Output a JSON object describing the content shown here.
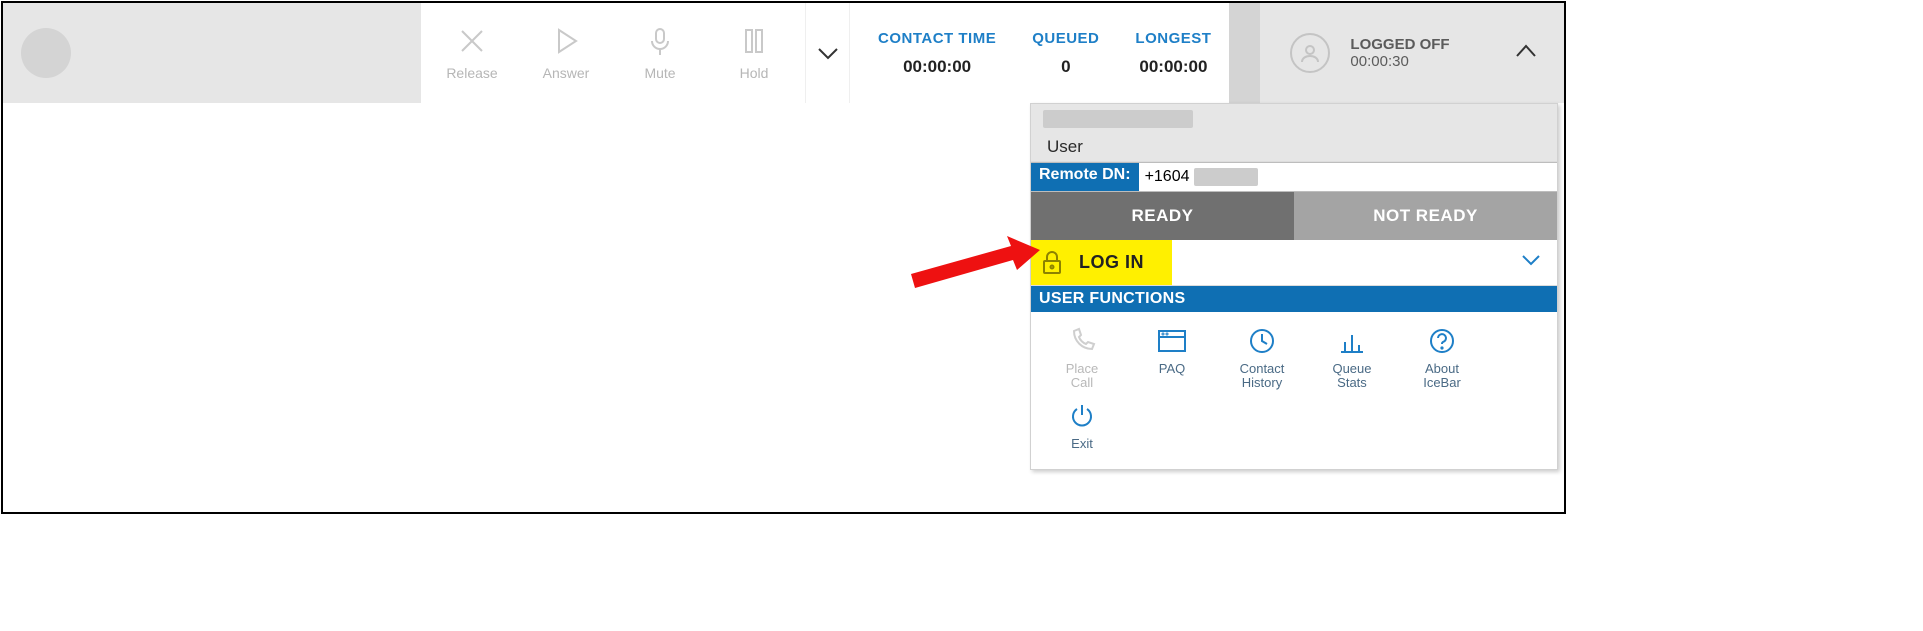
{
  "toolbar": {
    "release_label": "Release",
    "answer_label": "Answer",
    "mute_label": "Mute",
    "hold_label": "Hold"
  },
  "stats": {
    "contact_label": "CONTACT TIME",
    "contact_value": "00:00:00",
    "queued_label": "QUEUED",
    "queued_value": "0",
    "longest_label": "LONGEST",
    "longest_value": "00:00:00"
  },
  "status": {
    "label": "LOGGED OFF",
    "time": "00:00:30"
  },
  "panel": {
    "user_label": "User",
    "remote_dn_label": "Remote DN:",
    "remote_dn_value": "+1604",
    "ready_label": "READY",
    "not_ready_label": "NOT READY",
    "login_label": "LOG IN",
    "user_functions_header": "USER FUNCTIONS",
    "funcs": {
      "place_call": "Place\nCall",
      "paq": "PAQ",
      "contact_history": "Contact\nHistory",
      "queue_stats": "Queue\nStats",
      "about_icebar": "About\nIceBar",
      "exit": "Exit"
    }
  }
}
